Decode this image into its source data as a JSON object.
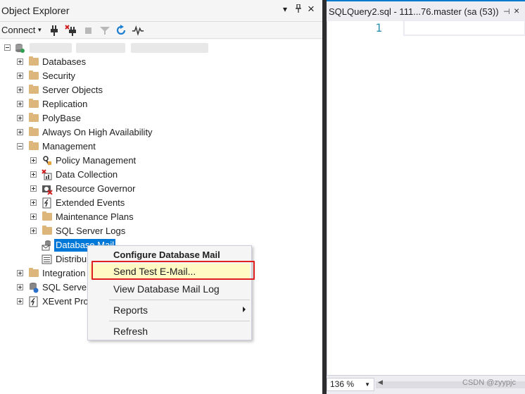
{
  "object_explorer": {
    "title": "Object Explorer",
    "pin_glyph": "▾",
    "dock_glyph": "ᵖ",
    "close_glyph": "×",
    "toolbar": {
      "connect_label": "Connect",
      "icons": [
        "connect-plug-icon",
        "disconnect-plug-icon",
        "stop-icon",
        "filter-icon",
        "refresh-icon",
        "activity-monitor-icon"
      ]
    }
  },
  "tree": {
    "items": [
      {
        "label": "Databases"
      },
      {
        "label": "Security"
      },
      {
        "label": "Server Objects"
      },
      {
        "label": "Replication"
      },
      {
        "label": "PolyBase"
      },
      {
        "label": "Always On High Availability"
      },
      {
        "label": "Management"
      },
      {
        "label": "Policy Management"
      },
      {
        "label": "Data Collection"
      },
      {
        "label": "Resource Governor"
      },
      {
        "label": "Extended Events"
      },
      {
        "label": "Maintenance Plans"
      },
      {
        "label": "SQL Server Logs"
      },
      {
        "label": "Database Mail"
      },
      {
        "label": "Distribu"
      },
      {
        "label": "Integration"
      },
      {
        "label": "SQL Server"
      },
      {
        "label": "XEvent Pro"
      }
    ]
  },
  "context_menu": {
    "items": [
      {
        "label": "Configure Database Mail"
      },
      {
        "label": "Send Test E-Mail..."
      },
      {
        "label": "View Database Mail Log"
      },
      {
        "label": "Reports"
      },
      {
        "label": "Refresh"
      }
    ]
  },
  "editor": {
    "tab_label": "SQLQuery2.sql - 111...76.master (sa (53))",
    "pin_glyph": "⊣",
    "close_glyph": "×",
    "line_number": "1",
    "zoom": "136 %"
  },
  "watermark": "CSDN @zyypjc",
  "colors": {
    "selection": "#0078d7",
    "highlight_border": "#e02020",
    "folder": "#dcb67a",
    "line_number": "#2b91af"
  }
}
